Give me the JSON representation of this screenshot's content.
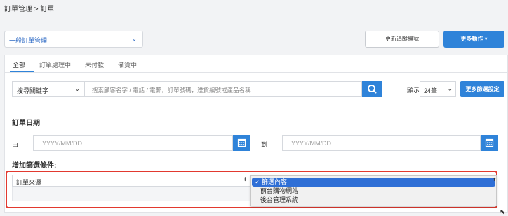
{
  "breadcrumb": "訂單管理 > 訂單",
  "order_type": {
    "value": "一般訂單管理",
    "icon": "chevron-down-icon"
  },
  "actions": {
    "tracking_button": "更新追蹤編號",
    "more_actions_button": "更多動作 ▾"
  },
  "tabs": [
    {
      "label": "全部",
      "active": true
    },
    {
      "label": "訂單處理中"
    },
    {
      "label": "未付款"
    },
    {
      "label": "備貨中"
    }
  ],
  "search": {
    "keyword_select": "搜尋關鍵字",
    "placeholder": "搜索顧客名字 / 電話 / 電郵，訂單號碼，送貨編號或產品名稱",
    "show_label": "顯示",
    "page_size": "24筆",
    "more_filters_button": "更多篩選設定"
  },
  "date_filter": {
    "title": "訂單日期",
    "from_label": "由",
    "to_label": "到",
    "from_placeholder": "YYYY/MM/DD",
    "to_placeholder": "YYYY/MM/DD"
  },
  "add_filter": {
    "title": "增加篩選條件:",
    "field_value": "訂單來源",
    "options": [
      {
        "label": "✓ 篩選內容",
        "selected": true
      },
      {
        "label": "前台購物網站"
      },
      {
        "label": "後台管理系統"
      }
    ]
  },
  "colors": {
    "accent": "#2f83d9",
    "highlight_border": "#e2392f",
    "selected_option": "#2f6fd6"
  }
}
